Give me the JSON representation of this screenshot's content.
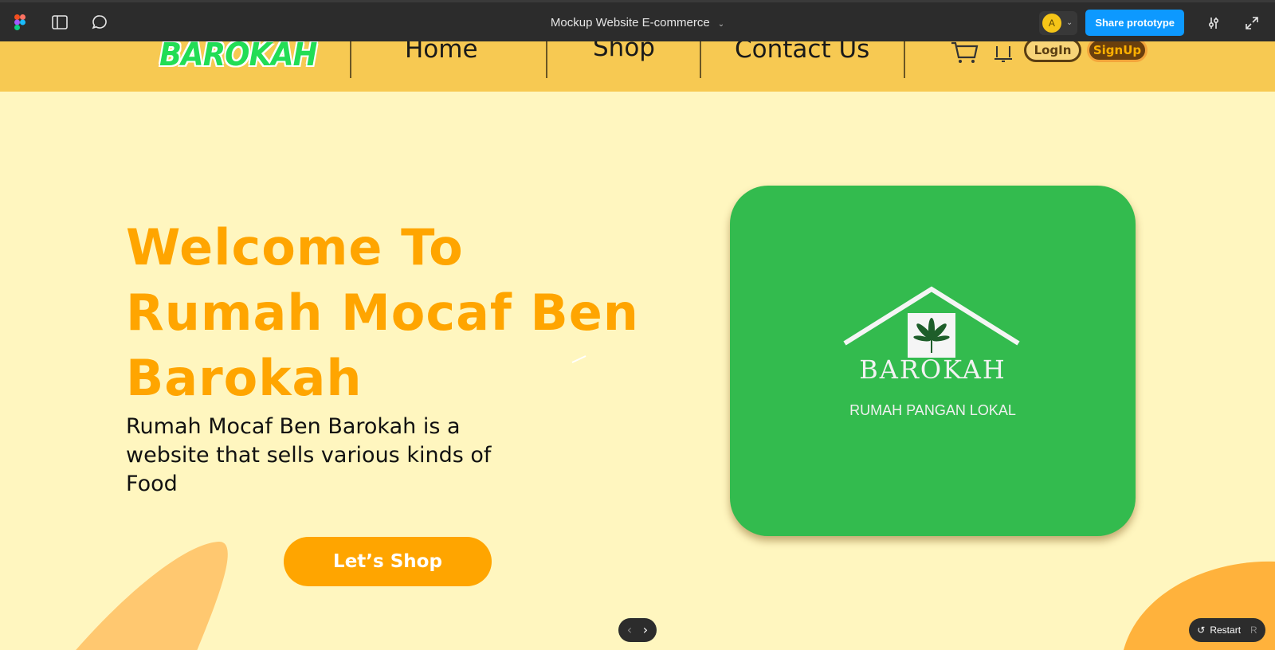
{
  "toolbar": {
    "file_title": "Mockup Website E-commerce",
    "avatar_initial": "A",
    "share_label": "Share prototype",
    "icons": [
      "figma-logo-icon",
      "sidebar-toggle-icon",
      "comment-icon",
      "settings-sliders-icon",
      "fullscreen-icon"
    ]
  },
  "site": {
    "brand": "BAROKAH",
    "nav": {
      "home": "Home",
      "shop": "Shop",
      "contact": "Contact Us"
    },
    "login_label": "LogIn",
    "signup_label": "SignUp",
    "hero": {
      "line1": "Welcome To",
      "line2": "Rumah Mocaf Ben",
      "line3": "Barokah",
      "subtitle": "Rumah Mocaf Ben Barokah is a website that sells various kinds of Food",
      "cta_label": "Let’s Shop"
    },
    "logo": {
      "name": "BAROKAH",
      "tagline": "RUMAH PANGAN LOKAL"
    }
  },
  "viewer": {
    "restart_label": "Restart",
    "restart_key": "R"
  },
  "colors": {
    "toolbar_bg": "#2c2c2c",
    "share_blue": "#0d99ff",
    "nav_bg": "#f7c952",
    "page_bg": "#fff6bf",
    "accent_orange": "#ffa500",
    "logo_green": "#33bb4e",
    "brand_green": "#22dd55"
  }
}
